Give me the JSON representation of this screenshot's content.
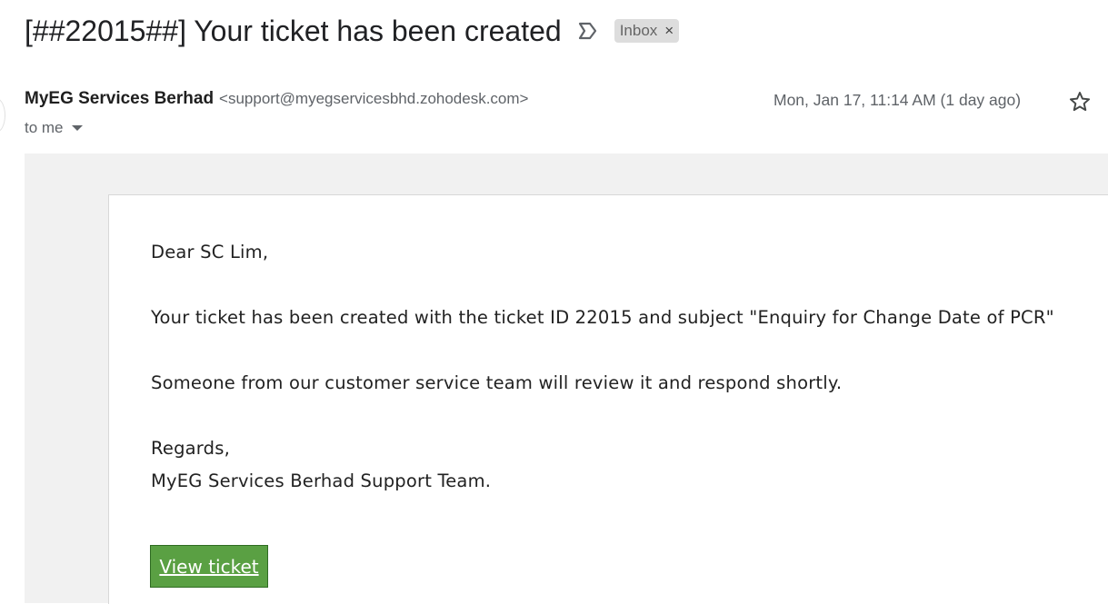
{
  "header": {
    "subject": "[##22015##] Your ticket has been created",
    "label": "Inbox",
    "label_close": "×"
  },
  "message": {
    "sender_name": "MyEG Services Berhad",
    "sender_email": "<support@myegservicesbhd.zohodesk.com>",
    "recipient": "to me",
    "date": "Mon, Jan 17, 11:14 AM (1 day ago)"
  },
  "body": {
    "greeting": "Dear SC Lim,",
    "line1": "Your ticket has been created with the ticket ID 22015 and subject \"Enquiry for Change Date of PCR\"",
    "line2": "Someone from our customer service team will review it and respond shortly.",
    "regards": "Regards,",
    "signature": "MyEG Services Berhad Support Team.",
    "button_label": "View ticket"
  },
  "icons": {
    "importance": "importance-marker-icon",
    "star": "star-outline-icon",
    "dropdown": "caret-down-icon"
  },
  "colors": {
    "button_bg": "#5aa043",
    "button_border": "#2f6b22",
    "frame_bg": "#f1f1f1",
    "chip_bg": "#dddddd"
  }
}
